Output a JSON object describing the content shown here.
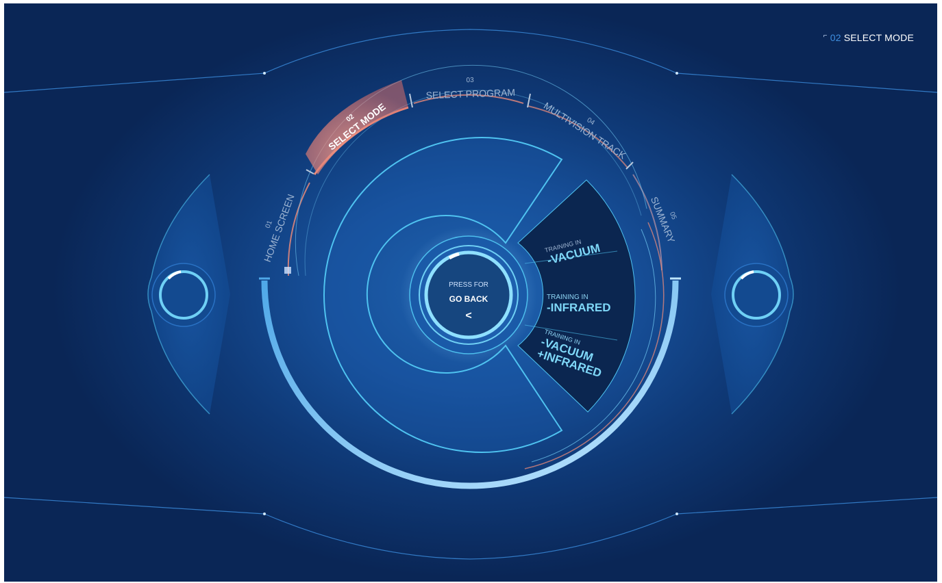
{
  "header": {
    "step_number": "02",
    "step_title": "SELECT MODE"
  },
  "steps": [
    {
      "number": "01",
      "label": "HOME SCREEN"
    },
    {
      "number": "02",
      "label": "SELECT MODE"
    },
    {
      "number": "03",
      "label": "SELECT PROGRAM"
    },
    {
      "number": "04",
      "label": "MULTIVISION TRACK"
    },
    {
      "number": "05",
      "label": "SUMMARY"
    }
  ],
  "active_step": 2,
  "center_button": {
    "line1": "PRESS FOR",
    "line2": "GO BACK",
    "arrow": "<"
  },
  "modes": [
    {
      "prefix": "TRAINING IN",
      "line1": "-VACUUM",
      "line2": ""
    },
    {
      "prefix": "TRAINING IN",
      "line1": "-INFRARED",
      "line2": ""
    },
    {
      "prefix": "TRAINING IN",
      "line1": "-VACUUM",
      "line2": "+INFRARED"
    }
  ],
  "colors": {
    "accent": "#4fc3f0",
    "active": "#e88a7a",
    "background": "#12489a"
  }
}
